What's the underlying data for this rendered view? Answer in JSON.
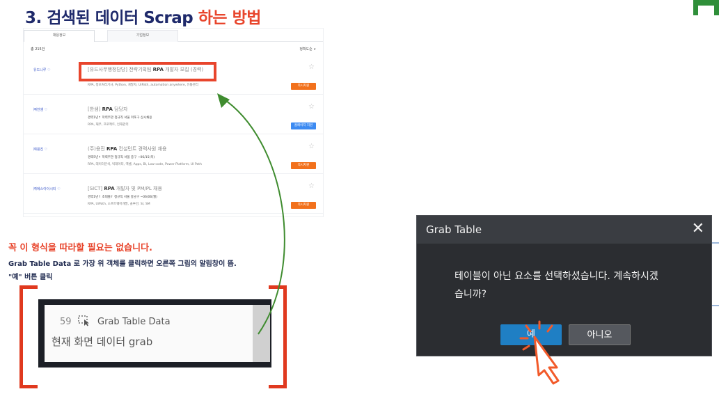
{
  "slide": {
    "title_prefix": "3. 검색된 데이터 Scrap ",
    "title_highlight": "하는 방법"
  },
  "joblist": {
    "tabs": [
      "채용정보",
      "기업정보"
    ],
    "count": "총 215건",
    "sort": "정확도순 ∨",
    "rows": [
      {
        "company": "유드니루 ♡",
        "title_pre": "[유드사무행정담당] 전략기획팀 ",
        "title_bold": "RPA",
        "title_post": " 개발자 모집 (경력)",
        "meta1": "",
        "meta2": "RPA, 정보처리기사, Python, 개발자, UiPath, automation anywhere, 유통관리",
        "button": "즉시지원",
        "button_color": "orange"
      },
      {
        "company": "㈜한샘 ♡",
        "title_pre": "[한샘] ",
        "title_bold": "RPA",
        "title_post": " 담당자",
        "meta1": "경력1년↑   학력무관   정규직   서울 마포구   상시채용",
        "meta2": "RPA, 재무, 프로젝트, 인재관리",
        "button": "홈페이지 지원",
        "button_color": "blue"
      },
      {
        "company": "㈜용진 ♡",
        "title_pre": "(주)용진 ",
        "title_bold": "RPA",
        "title_post": " 컨설턴트 경력사원 채용",
        "meta1": "경력5년↑   학력무관   정규직   서울 중구   ~06/15(목)",
        "meta2": "RPA, 데이터분석, 빅데이터, 엑셀, Apps, BI, Low-code, Power Platform, UI Path",
        "button": "즉시지원",
        "button_color": "orange"
      },
      {
        "company": "㈜에스아이시티 ♡",
        "title_pre": "[SICT] ",
        "title_bold": "RPA",
        "title_post": " 개발자 및 PM/PL 채용",
        "meta1": "경력1년↑   초대졸↑   정규직   서울 강남구   ~06/06(월)",
        "meta2": "RPA, UiPath, 소프트웨어개발, 솔루션, SI, SM",
        "button": "즉시지원",
        "button_color": "orange"
      }
    ]
  },
  "notes": {
    "red": "꼭 이 형식을 따라할 필요는 없습니다.",
    "line1": "Grab Table Data 로 가장 위 객체를 클릭하면 오른쪽 그림의 알림창이 뜸.",
    "line2": "\"예\" 버튼 클릭"
  },
  "activity": {
    "number": "59",
    "icon": "grab-table-icon",
    "name": "Grab Table Data",
    "description": "현재 화면 데이터 grab"
  },
  "dialog": {
    "title": "Grab Table",
    "close": "✕",
    "message_line1": "테이블이 아닌 요소를 선택하셨습니다. 계속하시겠",
    "message_line2": "습니까?",
    "yes": "예",
    "no": "아니오"
  },
  "colors": {
    "title_dark": "#1f2a6b",
    "accent_red": "#e8452c",
    "arrow_green": "#3f8c2f",
    "dialog_bg": "#2b2d31",
    "yes_blue": "#1f7fc4"
  }
}
